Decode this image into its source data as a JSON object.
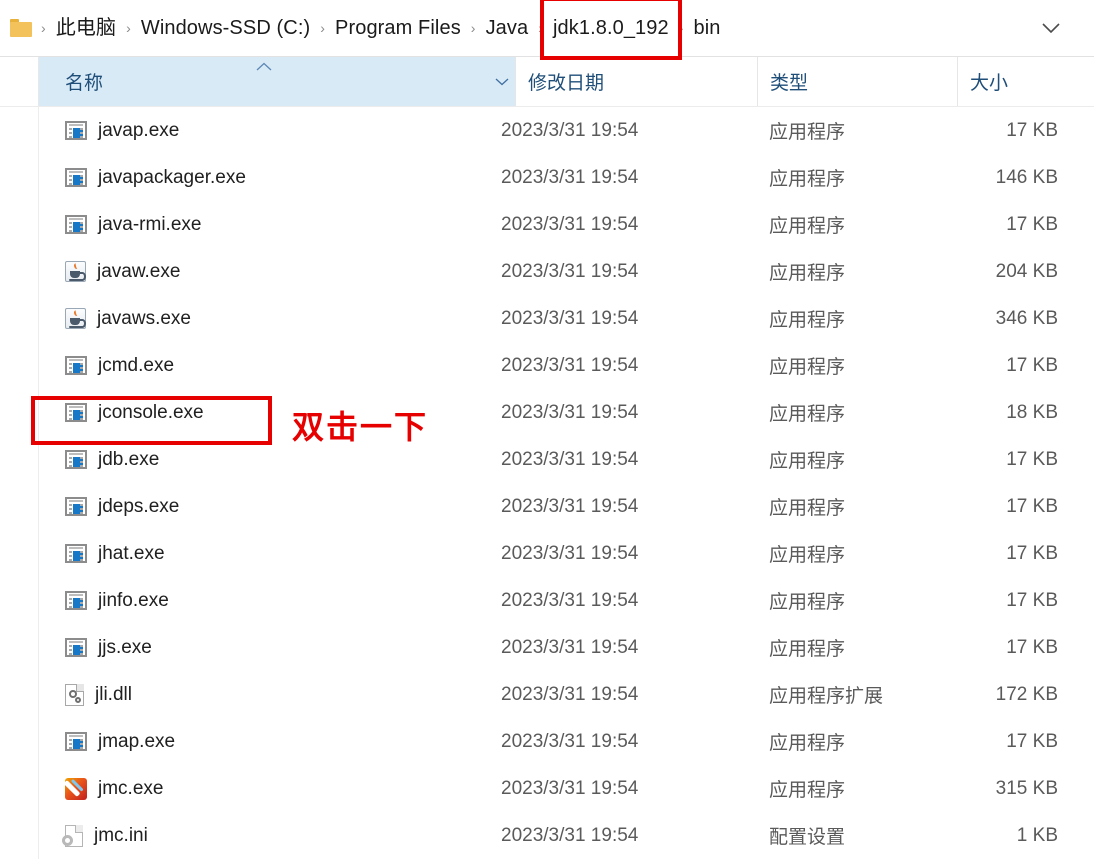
{
  "window": {
    "address_bar": {
      "folder_icon": "folder-icon",
      "crumbs": [
        {
          "label": "此电脑",
          "highlighted": false
        },
        {
          "label": "Windows-SSD (C:)",
          "highlighted": false
        },
        {
          "label": "Program Files",
          "highlighted": false
        },
        {
          "label": "Java",
          "highlighted": false
        },
        {
          "label": "jdk1.8.0_192",
          "highlighted": true
        },
        {
          "label": "bin",
          "highlighted": false
        }
      ],
      "separator": "›",
      "dropdown_icon": "chevron-down-icon"
    },
    "columns": {
      "name": "名称",
      "date_modified": "修改日期",
      "type": "类型",
      "size": "大小",
      "sort_caret": "︿",
      "name_chevron": "﹀"
    },
    "files": [
      {
        "name": "javap.exe",
        "icon": "exe",
        "date": "2023/3/31 19:54",
        "type": "应用程序",
        "size": "17 KB"
      },
      {
        "name": "javapackager.exe",
        "icon": "exe",
        "date": "2023/3/31 19:54",
        "type": "应用程序",
        "size": "146 KB"
      },
      {
        "name": "java-rmi.exe",
        "icon": "exe",
        "date": "2023/3/31 19:54",
        "type": "应用程序",
        "size": "17 KB"
      },
      {
        "name": "javaw.exe",
        "icon": "java",
        "date": "2023/3/31 19:54",
        "type": "应用程序",
        "size": "204 KB"
      },
      {
        "name": "javaws.exe",
        "icon": "java",
        "date": "2023/3/31 19:54",
        "type": "应用程序",
        "size": "346 KB"
      },
      {
        "name": "jcmd.exe",
        "icon": "exe",
        "date": "2023/3/31 19:54",
        "type": "应用程序",
        "size": "17 KB"
      },
      {
        "name": "jconsole.exe",
        "icon": "exe",
        "date": "2023/3/31 19:54",
        "type": "应用程序",
        "size": "18 KB"
      },
      {
        "name": "jdb.exe",
        "icon": "exe",
        "date": "2023/3/31 19:54",
        "type": "应用程序",
        "size": "17 KB"
      },
      {
        "name": "jdeps.exe",
        "icon": "exe",
        "date": "2023/3/31 19:54",
        "type": "应用程序",
        "size": "17 KB"
      },
      {
        "name": "jhat.exe",
        "icon": "exe",
        "date": "2023/3/31 19:54",
        "type": "应用程序",
        "size": "17 KB"
      },
      {
        "name": "jinfo.exe",
        "icon": "exe",
        "date": "2023/3/31 19:54",
        "type": "应用程序",
        "size": "17 KB"
      },
      {
        "name": "jjs.exe",
        "icon": "exe",
        "date": "2023/3/31 19:54",
        "type": "应用程序",
        "size": "17 KB"
      },
      {
        "name": "jli.dll",
        "icon": "dll",
        "date": "2023/3/31 19:54",
        "type": "应用程序扩展",
        "size": "172 KB"
      },
      {
        "name": "jmap.exe",
        "icon": "exe",
        "date": "2023/3/31 19:54",
        "type": "应用程序",
        "size": "17 KB"
      },
      {
        "name": "jmc.exe",
        "icon": "jmc",
        "date": "2023/3/31 19:54",
        "type": "应用程序",
        "size": "315 KB"
      },
      {
        "name": "jmc.ini",
        "icon": "ini",
        "date": "2023/3/31 19:54",
        "type": "配置设置",
        "size": "1 KB"
      }
    ],
    "annotations": {
      "instruction_text": "双击一下",
      "highlight_color": "#e60000",
      "highlighted_file": "jconsole.exe",
      "highlighted_crumb": "jdk1.8.0_192"
    }
  }
}
